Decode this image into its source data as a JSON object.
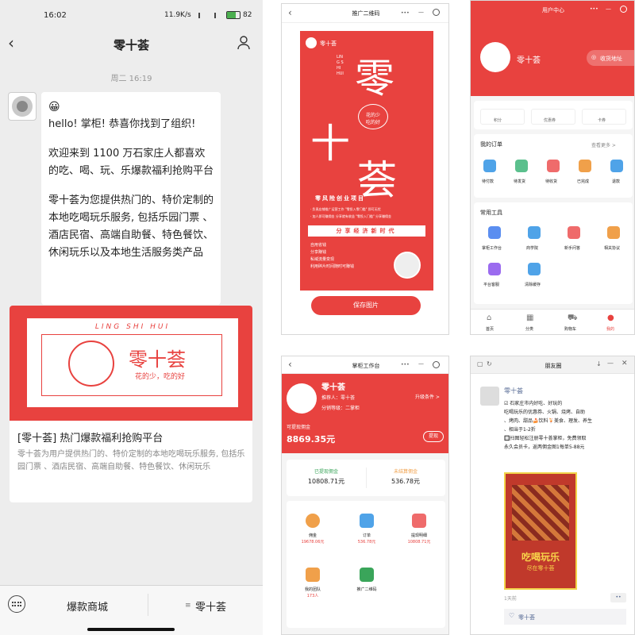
{
  "chat": {
    "status_time": "16:02",
    "network": "11.9K/s",
    "battery": "82",
    "title": "零十荟",
    "timestamp": "周二 16:19",
    "emoji": "😀",
    "msg_p1": "hello! 掌柜! 恭喜你找到了组织!",
    "msg_p2": "欢迎来到 1100 万石家庄人都喜欢的吃、喝、玩、乐爆款福利抢购平台",
    "msg_p3": "零十荟为您提供热门的、特价定制的本地吃喝玩乐服务, 包括乐园门票 、酒店民宿、高端自助餐、特色餐饮、休闲玩乐以及本地生活服务类产品",
    "card_pinyin": "LING SHI HUI",
    "card_logo_text": "零十荟",
    "card_slogan": "花的少，吃的好",
    "card_title": "[零十荟] 热门爆款福利抢购平台",
    "card_desc": "零十荟为用户提供热门的、特价定制的本地吃喝玩乐服务, 包括乐园门票 、酒店民宿、高端自助餐、特色餐饮、休闲玩乐",
    "bottom_left": "爆款商城",
    "bottom_right": "零十荟"
  },
  "poster": {
    "title": "推广二维码",
    "brand": "零十荟",
    "big_char1": "零",
    "big_char2": "十",
    "big_char3": "荟",
    "pinyin": "LING SHI HUI",
    "seal_line1": "花的少",
    "seal_line2": "吃的好",
    "project": "零风险创业项目",
    "line1": "· 负责店铺推广运营工作 \"零投入零门槛\" 即可无忧",
    "line2": "· 加人即可赚佣金 分享就有收益 \"零投入门槛\" 分享赚佣金",
    "banner": "分享经济新时代",
    "sub1": "自用省钱",
    "sub2": "分享赚钱",
    "sub3": "私域流量变现",
    "sub4": "利用碎片时间随时可赚钱",
    "save_button": "保存图片"
  },
  "user_center": {
    "title": "用户中心",
    "name": "零十荟",
    "collect": "收货地址",
    "stat1": "积分",
    "stat2": "优惠券",
    "stat3": "卡券",
    "orders_title": "我的订单",
    "orders_more": "查看更多 >",
    "orders": [
      "待付款",
      "待发货",
      "待收货",
      "已完成",
      "退款"
    ],
    "tools_title": "常用工具",
    "tools": [
      "掌柜工作台",
      "商学院",
      "新手问答",
      "相关协议",
      "平台客服",
      "清除缓存"
    ],
    "nav": [
      "首页",
      "分类",
      "购物车",
      "我的"
    ]
  },
  "workbench": {
    "title": "掌柜工作台",
    "name": "零十荟",
    "recommender": "推荐人：零十荟",
    "level": "分销等级：二掌柜",
    "upgrade": "升级条件 >",
    "withdrawable_label": "可提现佣金",
    "withdrawable": "8869.35元",
    "withdraw_button": "提现",
    "withdrawn_label": "已提现佣金",
    "withdrawn": "10808.71元",
    "unsettled_label": "未结算佣金",
    "unsettled": "536.78元",
    "items": [
      {
        "label": "佣金",
        "value": "19678.06元"
      },
      {
        "label": "订单",
        "value": "536.78元"
      },
      {
        "label": "提现明细",
        "value": "10808.71元"
      },
      {
        "label": "我的团队",
        "value": "173人"
      },
      {
        "label": "推广二维码",
        "value": ""
      }
    ]
  },
  "moments": {
    "title": "朋友圈",
    "name": "零十荟",
    "line1": "☑ 石家庄市内好吃、好玩的",
    "line2": "吃喝玩乐的优惠券、火锅、烧烤、自助",
    "line3": "、烤肉、甜品🍰饮料🍹美食、理发、养生",
    "line4": "、相当于1-2折",
    "line5": "🔲扫图轻松注册零十荟掌柜，免费领取",
    "line6": "永久会员卡，返两佣金图1每单5-88元",
    "image_title": "吃喝玩乐",
    "image_sub": "尽在零十荟",
    "time": "1天前",
    "like": "零十荟"
  },
  "colors": {
    "brand_red": "#e8423f",
    "gray_bg": "#ededed"
  }
}
